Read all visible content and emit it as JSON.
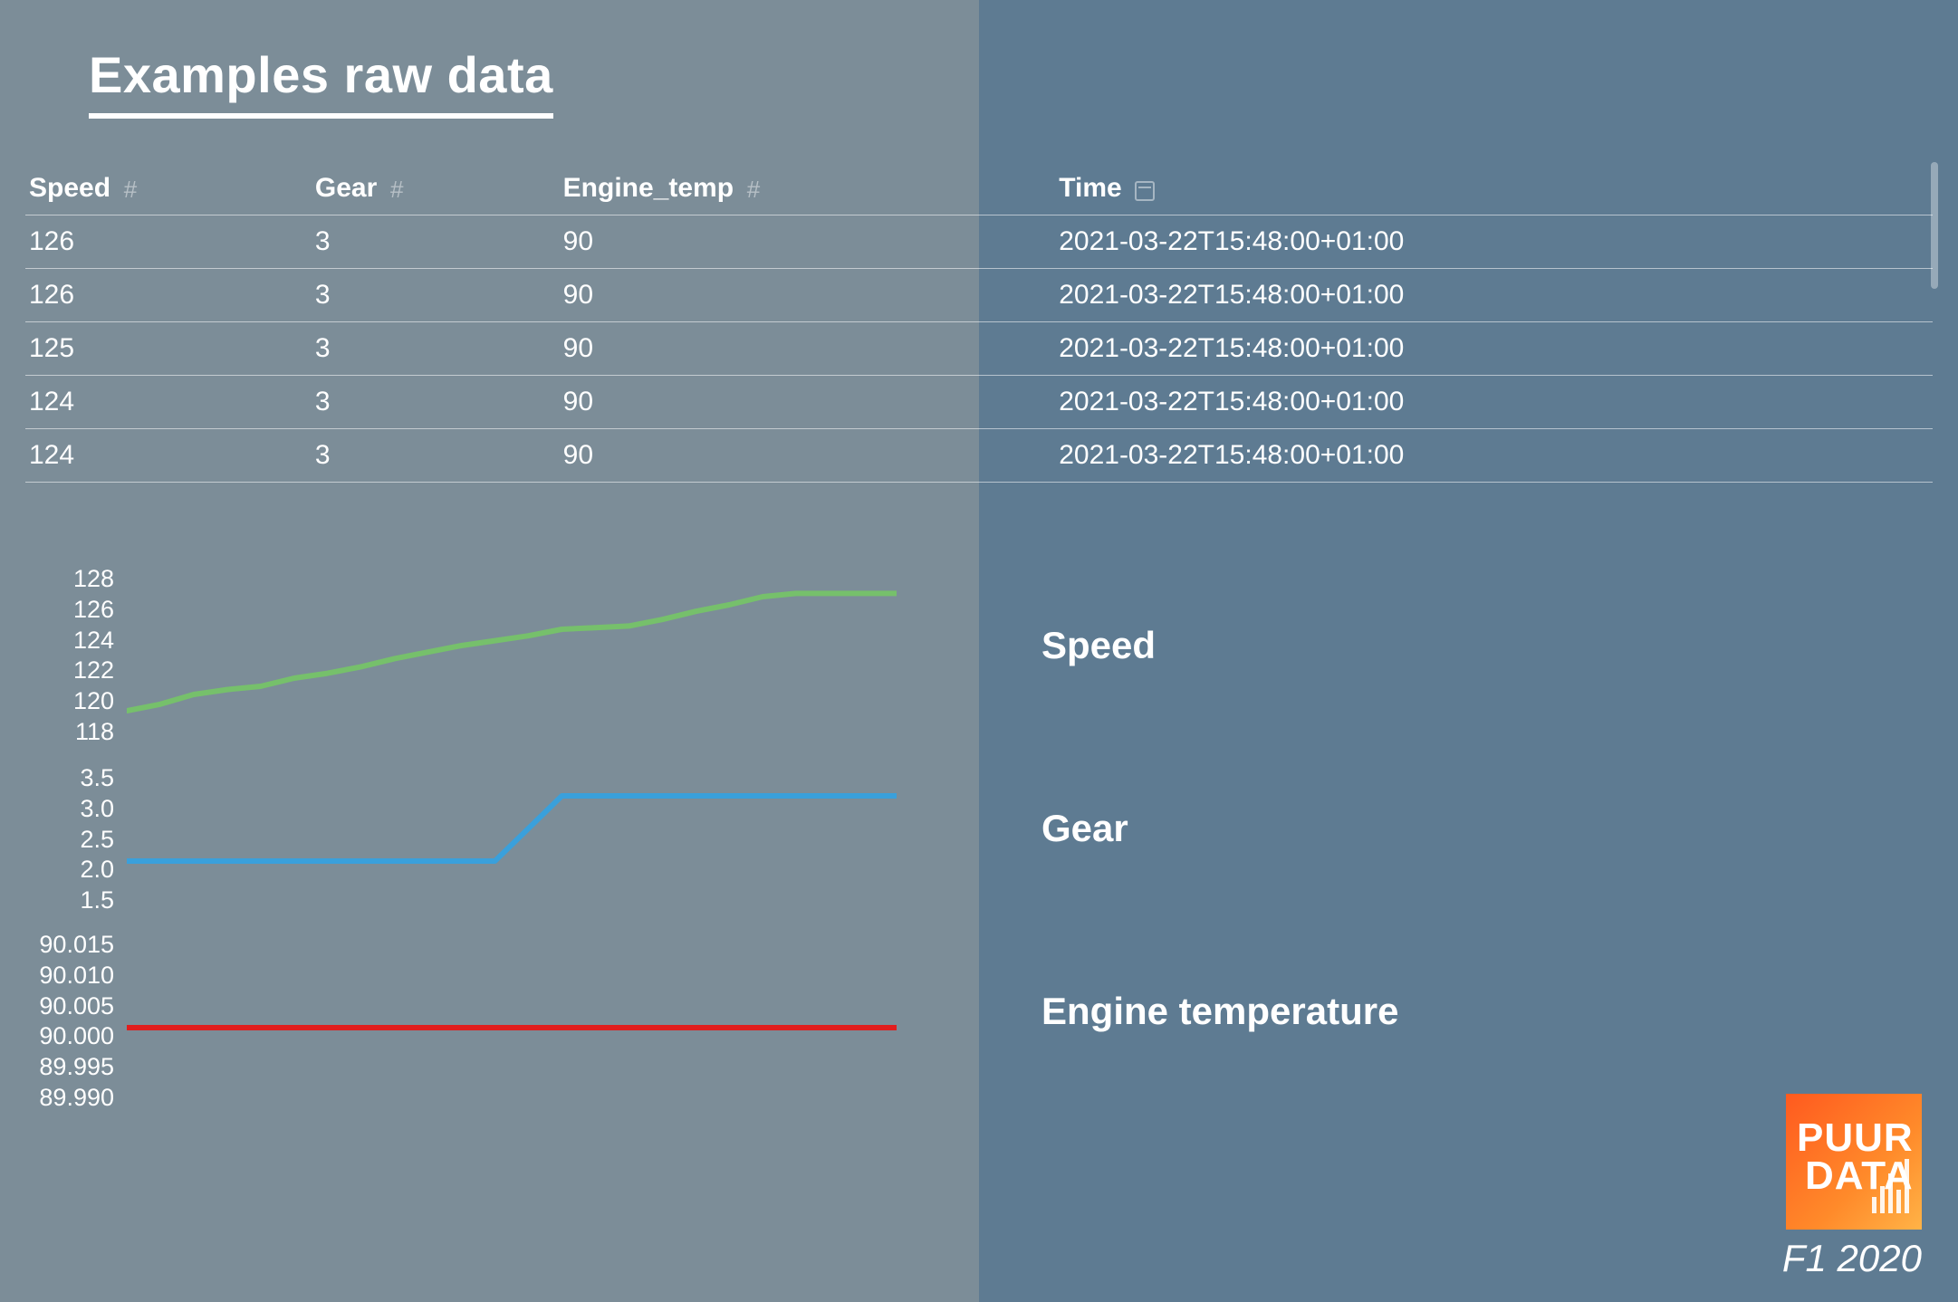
{
  "title": "Examples raw data",
  "columns": [
    {
      "label": "Speed",
      "type": "number"
    },
    {
      "label": "Gear",
      "type": "number"
    },
    {
      "label": "Engine_temp",
      "type": "number"
    },
    {
      "label": "Time",
      "type": "datetime"
    }
  ],
  "rows": [
    {
      "speed": "126",
      "gear": "3",
      "engine_temp": "90",
      "time": "2021-03-22T15:48:00+01:00"
    },
    {
      "speed": "126",
      "gear": "3",
      "engine_temp": "90",
      "time": "2021-03-22T15:48:00+01:00"
    },
    {
      "speed": "125",
      "gear": "3",
      "engine_temp": "90",
      "time": "2021-03-22T15:48:00+01:00"
    },
    {
      "speed": "124",
      "gear": "3",
      "engine_temp": "90",
      "time": "2021-03-22T15:48:00+01:00"
    },
    {
      "speed": "124",
      "gear": "3",
      "engine_temp": "90",
      "time": "2021-03-22T15:48:00+01:00"
    }
  ],
  "chart_data": [
    {
      "type": "line",
      "name": "Speed",
      "y_ticks": [
        128,
        126,
        124,
        122,
        120,
        118
      ],
      "ylim": [
        118,
        128
      ],
      "values": [
        119,
        119.4,
        120,
        120.3,
        120.5,
        121,
        121.3,
        121.7,
        122.2,
        122.6,
        123,
        123.3,
        123.6,
        124,
        124.1,
        124.2,
        124.6,
        125.1,
        125.5,
        126,
        126.2,
        126.2,
        126.2,
        126.2
      ],
      "color": "#76c06b"
    },
    {
      "type": "line",
      "name": "Gear",
      "y_ticks": [
        3.5,
        3.0,
        2.5,
        2.0,
        1.5
      ],
      "ylim": [
        1.5,
        3.5
      ],
      "values": [
        2,
        2,
        2,
        2,
        2,
        2,
        2,
        2,
        2,
        2,
        2,
        2,
        2.5,
        3,
        3,
        3,
        3,
        3,
        3,
        3,
        3,
        3,
        3,
        3
      ],
      "color": "#3aa0db"
    },
    {
      "type": "line",
      "name": "Engine temperature",
      "y_ticks": [
        90.015,
        90.01,
        90.005,
        90.0,
        89.995,
        89.99
      ],
      "ylim": [
        89.99,
        90.015
      ],
      "values": [
        90,
        90,
        90,
        90,
        90,
        90,
        90,
        90,
        90,
        90,
        90,
        90,
        90,
        90,
        90,
        90,
        90,
        90,
        90,
        90,
        90,
        90,
        90,
        90
      ],
      "color": "#e11d1d"
    }
  ],
  "logo": {
    "line1": "PUUR",
    "line2": "DATA"
  },
  "footer_caption": "F1 2020"
}
